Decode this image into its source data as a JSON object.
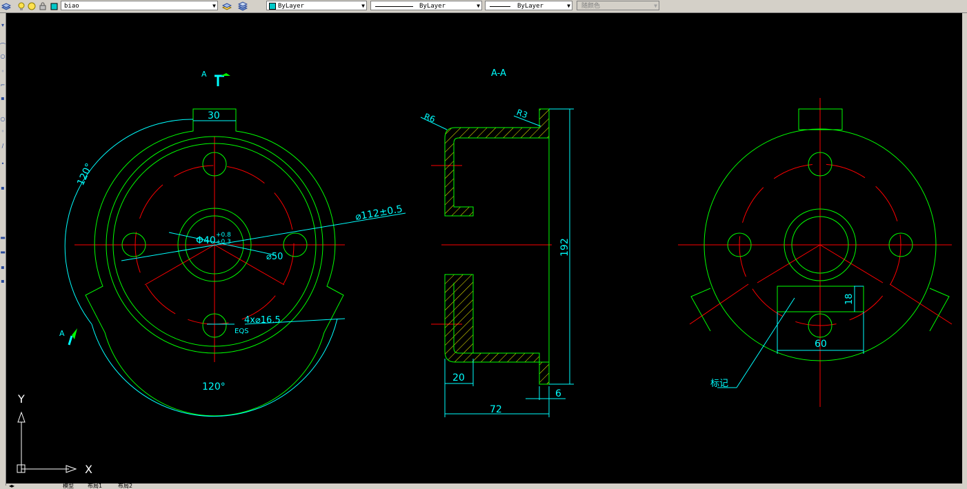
{
  "toolbar": {
    "layer_name": "biao",
    "color": "ByLayer",
    "linetype": "ByLayer",
    "lineweight": "ByLayer",
    "plot_style": "随颜色"
  },
  "drawing": {
    "section_title": "A-A",
    "cut_label_top": "A",
    "cut_label_bottom": "A",
    "dims": {
      "tab_width": "30",
      "angle_top": "120°",
      "angle_bottom": "120°",
      "outer_dia": "⌀112±0.5",
      "bore_dia": "Φ40",
      "bore_tol_upper": "+0.8",
      "bore_tol_lower": "+0.3",
      "hub_dia": "⌀50",
      "holes": "4x⌀16.5",
      "eqs": "EQS",
      "r6": "R6",
      "r3": "R3",
      "height": "192",
      "width_20": "20",
      "width_6": "6",
      "width_72": "72",
      "mark_height": "18",
      "mark_width": "60",
      "mark_label": "标记"
    }
  },
  "ucs": {
    "x_label": "X",
    "y_label": "Y"
  },
  "tabs": [
    "模型",
    "布局1",
    "布局2"
  ],
  "colors": {
    "canvas": "#000000",
    "geometry": "#00ff00",
    "center": "#ff0000",
    "dimension": "#00ffff",
    "hatch": "#ffff00"
  }
}
